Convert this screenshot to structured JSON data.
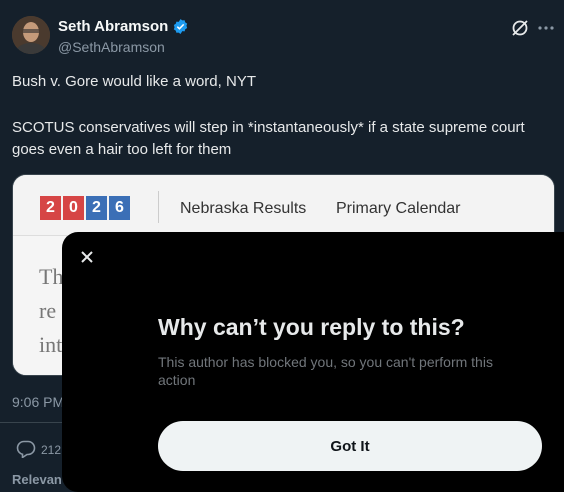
{
  "tweet": {
    "author_name": "Seth Abramson",
    "handle": "@SethAbramson",
    "text_lines": [
      "Bush v. Gore would like a word, NYT",
      "SCOTUS conservatives will step in *instantaneously* if a state supreme court goes even a hair too left for them"
    ],
    "timestamp": "9:06 PM",
    "reply_count": "212",
    "relevant_label": "Relevan"
  },
  "card": {
    "year_digits": [
      "2",
      "0",
      "2",
      "6"
    ],
    "nav_left": "Nebraska Results",
    "nav_right": "Primary Calendar",
    "fragments": [
      "Th",
      "re",
      "int"
    ]
  },
  "modal": {
    "title": "Why can’t you reply to this?",
    "body": "This author has blocked you, so you can't perform this action",
    "button_label": "Got It"
  },
  "colors": {
    "background": "#15202b",
    "modal_bg": "#000000",
    "verified": "#1d9bf0",
    "button_bg": "#eff3f4"
  }
}
